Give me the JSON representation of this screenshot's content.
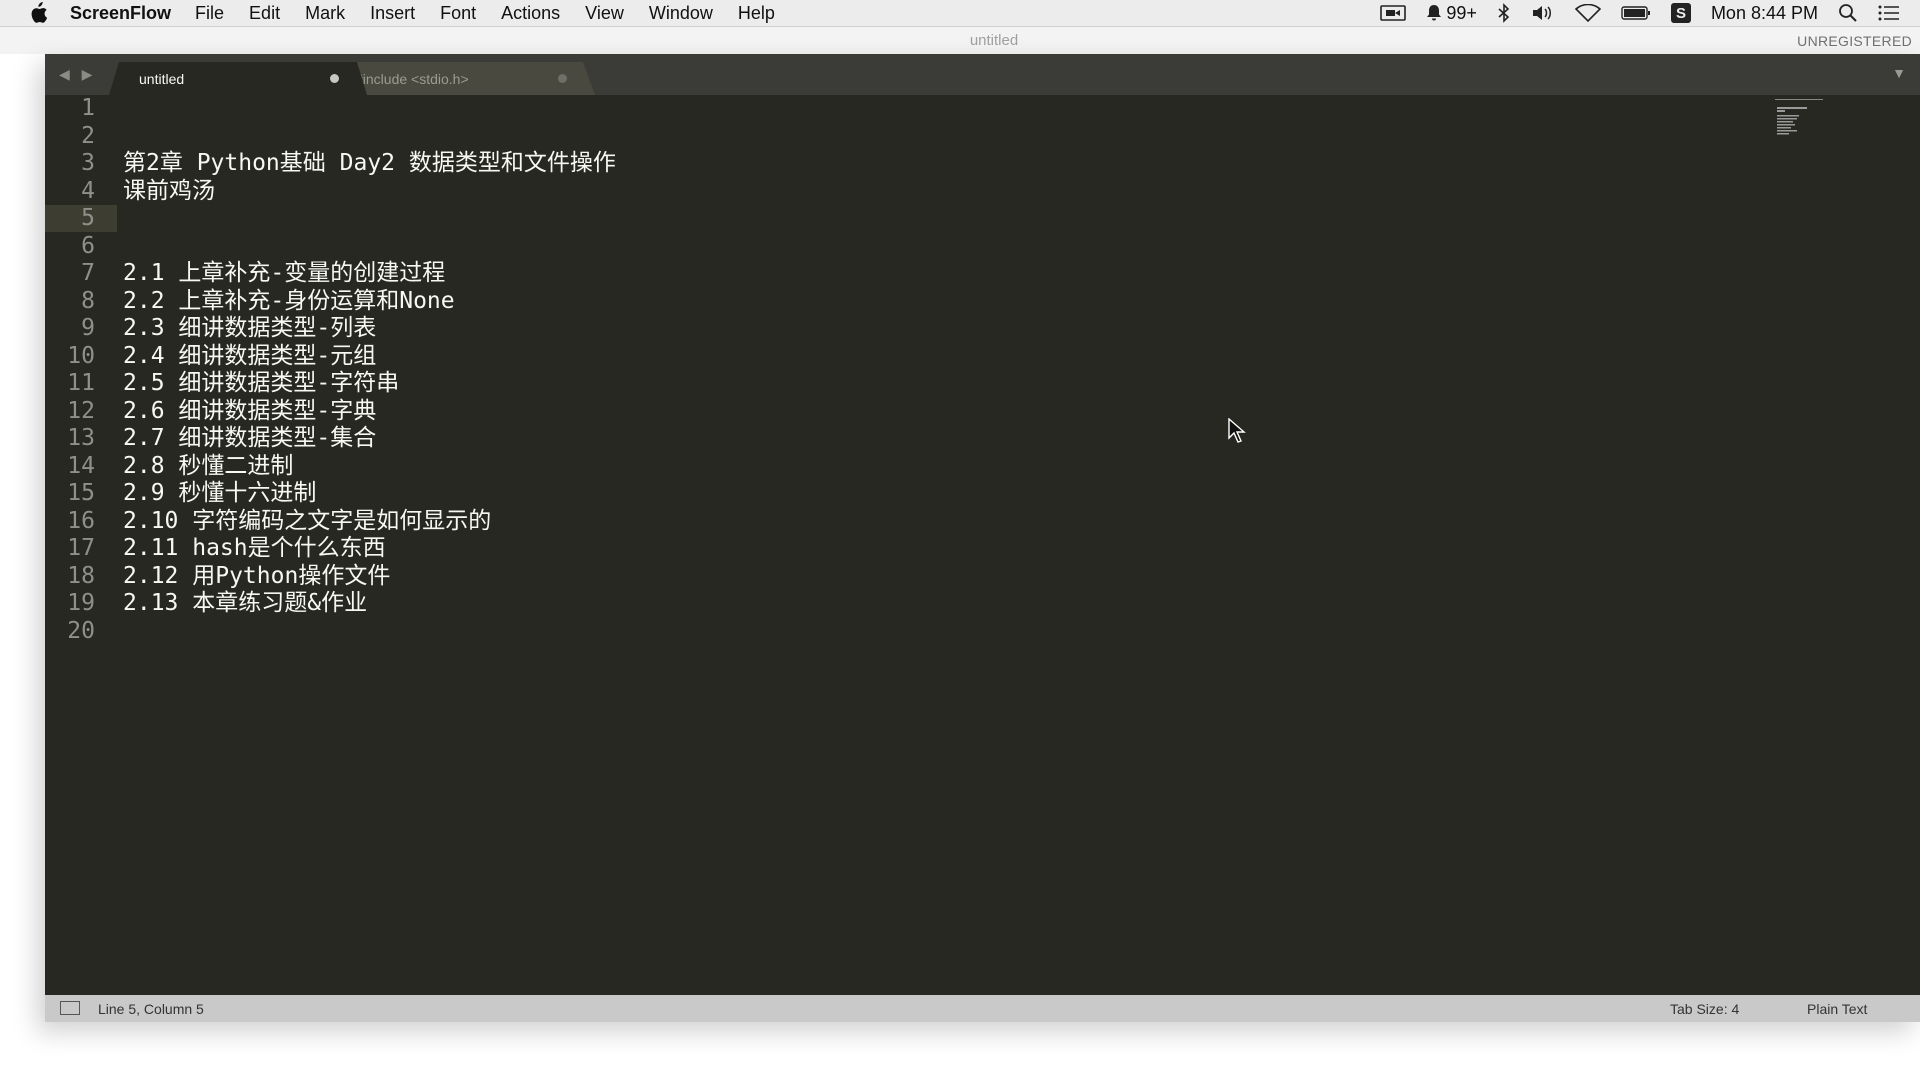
{
  "menubar": {
    "app_name": "ScreenFlow",
    "items": [
      "File",
      "Edit",
      "Mark",
      "Insert",
      "Font",
      "Actions",
      "View",
      "Window",
      "Help"
    ],
    "notification_count": "99+",
    "clock": "Mon 8:44 PM"
  },
  "window": {
    "title": "untitled",
    "unregistered_label": "UNREGISTERED",
    "tabs": [
      {
        "label": "untitled",
        "active": true
      },
      {
        "label": "#include <stdio.h>",
        "active": false
      }
    ]
  },
  "editor": {
    "lines": [
      {
        "num": "1",
        "text": ""
      },
      {
        "num": "2",
        "text": ""
      },
      {
        "num": "3",
        "text": "第2章 Python基础 Day2 数据类型和文件操作"
      },
      {
        "num": "4",
        "text": "课前鸡汤"
      },
      {
        "num": "5",
        "text": ""
      },
      {
        "num": "6",
        "text": ""
      },
      {
        "num": "7",
        "text": "2.1 上章补充-变量的创建过程"
      },
      {
        "num": "8",
        "text": "2.2 上章补充-身份运算和None"
      },
      {
        "num": "9",
        "text": "2.3 细讲数据类型-列表"
      },
      {
        "num": "10",
        "text": "2.4 细讲数据类型-元组"
      },
      {
        "num": "11",
        "text": "2.5 细讲数据类型-字符串"
      },
      {
        "num": "12",
        "text": "2.6 细讲数据类型-字典"
      },
      {
        "num": "13",
        "text": "2.7 细讲数据类型-集合"
      },
      {
        "num": "14",
        "text": "2.8 秒懂二进制"
      },
      {
        "num": "15",
        "text": "2.9 秒懂十六进制"
      },
      {
        "num": "16",
        "text": "2.10 字符编码之文字是如何显示的"
      },
      {
        "num": "17",
        "text": "2.11 hash是个什么东西"
      },
      {
        "num": "18",
        "text": "2.12 用Python操作文件"
      },
      {
        "num": "19",
        "text": "2.13 本章练习题&作业"
      },
      {
        "num": "20",
        "text": ""
      }
    ],
    "current_line": 5
  },
  "statusbar": {
    "cursor_position": "Line 5, Column 5",
    "tab_size": "Tab Size: 4",
    "syntax": "Plain Text"
  },
  "colors": {
    "editor_bg": "#272822",
    "tabbar_bg": "#3b3c37",
    "text": "#f8f8f2",
    "line_number": "#8f908a",
    "statusbar_bg": "#c9c9c9"
  },
  "icons": [
    "apple-icon",
    "camera-icon",
    "bell-icon",
    "bluetooth-icon",
    "volume-icon",
    "wifi-icon",
    "battery-icon",
    "s-app-icon",
    "search-icon",
    "list-icon",
    "panel-toggle-icon",
    "mouse-cursor-icon"
  ]
}
